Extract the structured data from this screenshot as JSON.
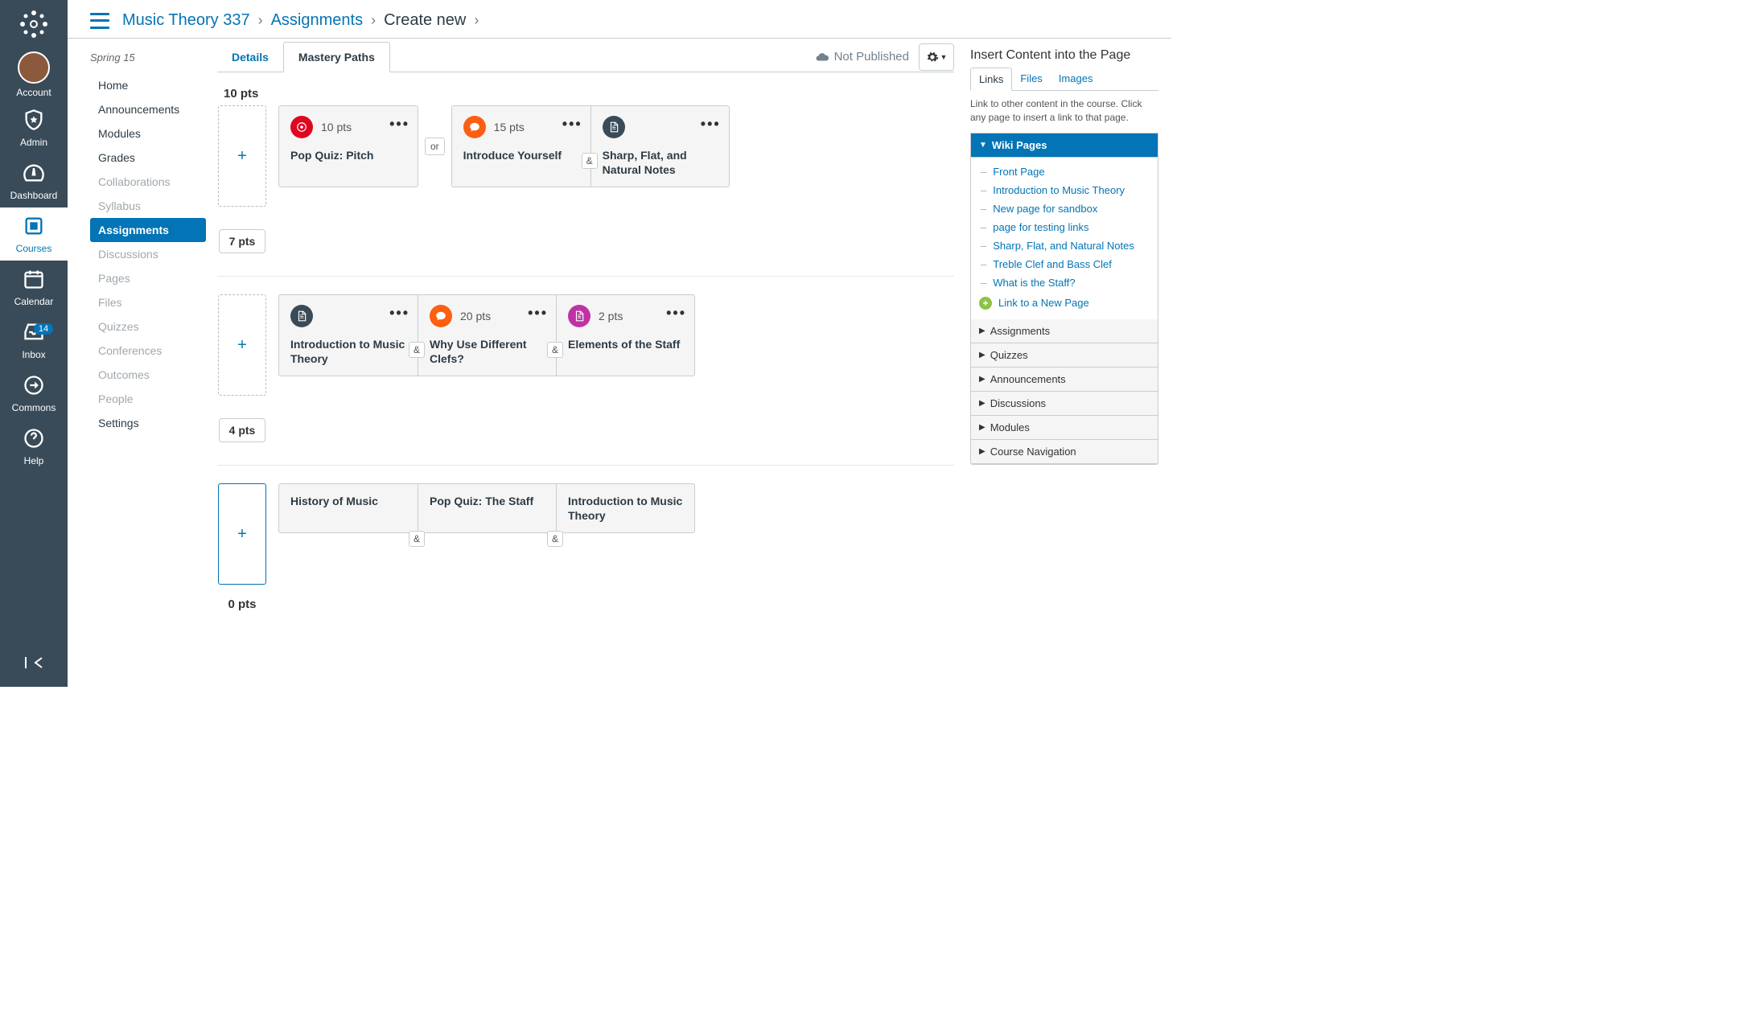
{
  "global_nav": {
    "items": [
      {
        "id": "account",
        "label": "Account"
      },
      {
        "id": "admin",
        "label": "Admin"
      },
      {
        "id": "dashboard",
        "label": "Dashboard"
      },
      {
        "id": "courses",
        "label": "Courses"
      },
      {
        "id": "calendar",
        "label": "Calendar"
      },
      {
        "id": "inbox",
        "label": "Inbox",
        "badge": "14"
      },
      {
        "id": "commons",
        "label": "Commons"
      },
      {
        "id": "help",
        "label": "Help"
      }
    ]
  },
  "breadcrumb": {
    "course": "Music Theory 337",
    "section": "Assignments",
    "current": "Create new"
  },
  "course_nav": {
    "term": "Spring 15",
    "items": [
      {
        "label": "Home"
      },
      {
        "label": "Announcements"
      },
      {
        "label": "Modules"
      },
      {
        "label": "Grades"
      },
      {
        "label": "Collaborations",
        "dim": true
      },
      {
        "label": "Syllabus",
        "dim": true
      },
      {
        "label": "Assignments",
        "active": true
      },
      {
        "label": "Discussions",
        "dim": true
      },
      {
        "label": "Pages",
        "dim": true
      },
      {
        "label": "Files",
        "dim": true
      },
      {
        "label": "Quizzes",
        "dim": true
      },
      {
        "label": "Conferences",
        "dim": true
      },
      {
        "label": "Outcomes",
        "dim": true
      },
      {
        "label": "People",
        "dim": true
      },
      {
        "label": "Settings"
      }
    ]
  },
  "tabs": {
    "details": "Details",
    "mastery": "Mastery Paths"
  },
  "status": {
    "label": "Not Published"
  },
  "points_header": "10 pts",
  "rows": [
    {
      "lower": "7 pts",
      "groups": [
        {
          "cards": [
            {
              "type": "quiz",
              "pts": "10 pts",
              "title": "Pop Quiz: Pitch"
            }
          ]
        },
        {
          "join": "or",
          "cards": [
            {
              "type": "discussion",
              "pts": "15 pts",
              "title": "Introduce Yourself"
            },
            {
              "type": "page",
              "join": "&",
              "title": "Sharp, Flat, and Natural Notes"
            }
          ]
        }
      ]
    },
    {
      "lower": "4 pts",
      "groups": [
        {
          "cards": [
            {
              "type": "page",
              "title": "Introduction to Music Theory"
            },
            {
              "type": "discussion",
              "pts": "20 pts",
              "join": "&",
              "title": "Why Use Different Clefs?"
            },
            {
              "type": "assign",
              "pts": "2 pts",
              "join": "&",
              "title": "Elements of the Staff"
            }
          ]
        }
      ]
    },
    {
      "selected": true,
      "lower_plain": "0 pts",
      "groups": [
        {
          "cards": [
            {
              "type": "plain",
              "title": "History of Music"
            },
            {
              "type": "plain",
              "join": "&",
              "title": "Pop Quiz: The Staff"
            },
            {
              "type": "plain",
              "join": "&",
              "title": "Introduction to Music Theory"
            }
          ]
        }
      ]
    }
  ],
  "right": {
    "title": "Insert Content into the Page",
    "tabs": {
      "links": "Links",
      "files": "Files",
      "images": "Images"
    },
    "help": "Link to other content in the course. Click any page to insert a link to that page.",
    "wiki_header": "Wiki Pages",
    "wiki_links": [
      "Front Page",
      "Introduction to Music Theory",
      "New page for sandbox",
      "page for testing links",
      "Sharp, Flat, and Natural Notes",
      "Treble Clef and Bass Clef",
      "What is the Staff?"
    ],
    "new_page": "Link to a New Page",
    "accordions": [
      "Assignments",
      "Quizzes",
      "Announcements",
      "Discussions",
      "Modules",
      "Course Navigation"
    ]
  }
}
